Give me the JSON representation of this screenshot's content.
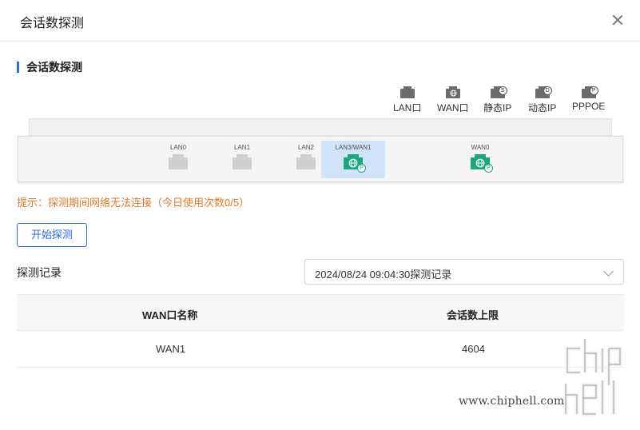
{
  "dialog": {
    "title": "会话数探测",
    "close_icon": "close-icon"
  },
  "section": {
    "title": "会话数探测"
  },
  "legend": [
    {
      "label": "LAN口",
      "icon": "lan-port-icon",
      "badge": ""
    },
    {
      "label": "WAN口",
      "icon": "wan-port-icon",
      "badge": ""
    },
    {
      "label": "静态IP",
      "icon": "static-ip-port-icon",
      "badge": "S"
    },
    {
      "label": "动态IP",
      "icon": "dynamic-ip-port-icon",
      "badge": "D"
    },
    {
      "label": "PPPOE",
      "icon": "pppoe-port-icon",
      "badge": "P"
    }
  ],
  "ports": [
    {
      "label": "LAN0",
      "state": "idle"
    },
    {
      "label": "LAN1",
      "state": "idle"
    },
    {
      "label": "LAN2",
      "state": "idle"
    },
    {
      "label": "LAN3/WAN1",
      "state": "active",
      "badge": "P"
    },
    {
      "label": "WAN0",
      "state": "wan",
      "badge": "P"
    }
  ],
  "hint": "提示：探测期间网络无法连接（今日使用次数0/5）",
  "start_button": "开始探测",
  "record": {
    "label": "探测记录",
    "selected": "2024/08/24 09:04:30探测记录"
  },
  "table": {
    "headers": [
      "WAN口名称",
      "会话数上限"
    ],
    "rows": [
      [
        "WAN1",
        "4604"
      ]
    ]
  },
  "watermark": {
    "url": "www.chiphell.com"
  },
  "colors": {
    "accent": "#2b6de5",
    "hint": "#e07a2a",
    "port_green": "#1aa57a",
    "active_port_bg": "#cfe3fb"
  }
}
